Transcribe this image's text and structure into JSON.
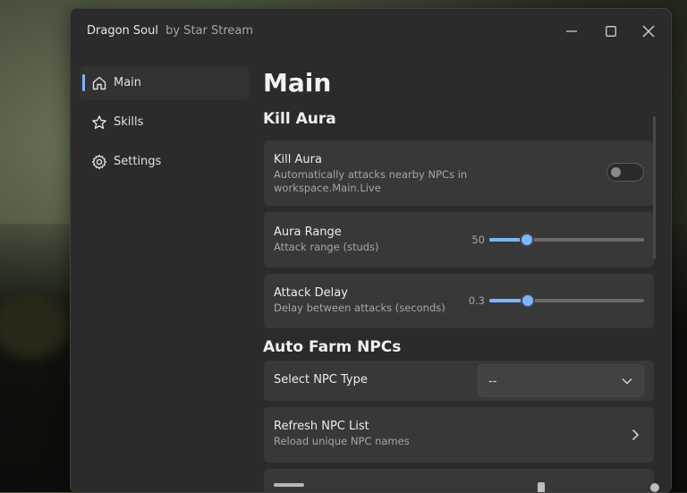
{
  "window": {
    "title": "Dragon Soul",
    "subtitle": "by Star Stream",
    "controls": [
      "minimize-icon",
      "maximize-icon",
      "close-icon"
    ]
  },
  "sidebar": {
    "items": [
      {
        "label": "Main",
        "icon": "home-icon",
        "active": true
      },
      {
        "label": "Skills",
        "icon": "star-icon",
        "active": false
      },
      {
        "label": "Settings",
        "icon": "gear-icon",
        "active": false
      }
    ]
  },
  "main": {
    "title": "Main",
    "kill_aura_section": {
      "title": "Kill Aura",
      "toggle": {
        "title": "Kill Aura",
        "description_line1": "Automatically attacks nearby NPCs in",
        "description_line2": "workspace.Main.Live",
        "enabled": false
      },
      "aura_range": {
        "title": "Aura Range",
        "description": "Attack range (studs)",
        "value": "50",
        "fill_fraction": 0.24
      },
      "attack_delay": {
        "title": "Attack Delay",
        "description": "Delay between attacks (seconds)",
        "value": "0.3",
        "fill_fraction": 0.25
      }
    },
    "auto_farm_section": {
      "title": "Auto Farm NPCs",
      "select_npc": {
        "title": "Select NPC Type",
        "selected": "--"
      },
      "refresh": {
        "title": "Refresh NPC List",
        "description": "Reload unique NPC names"
      }
    }
  },
  "colors": {
    "accent": "#7cb5ff",
    "window_bg": "#2b2b2b",
    "card_bg": "#383838"
  }
}
